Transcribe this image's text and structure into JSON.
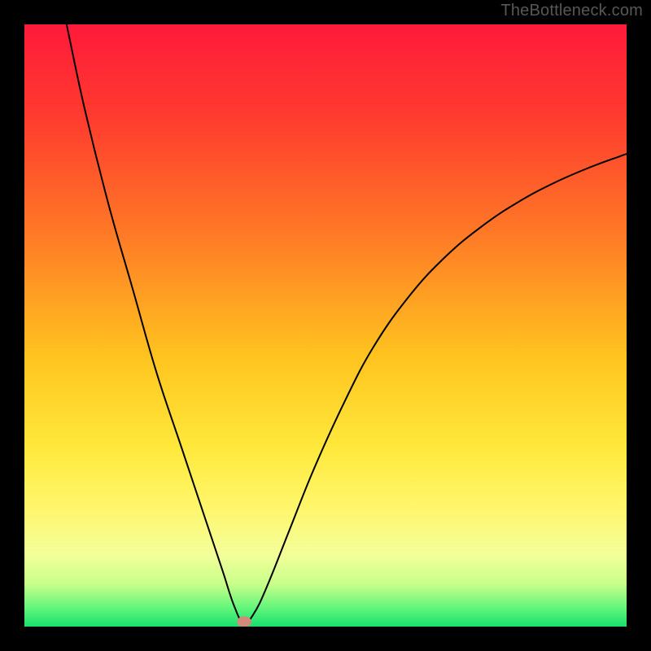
{
  "watermark": "TheBottleneck.com",
  "chart_data": {
    "type": "line",
    "title": "",
    "xlabel": "",
    "ylabel": "",
    "x_range": [
      0,
      100
    ],
    "y_range": [
      0,
      100
    ],
    "gradient_stops": [
      {
        "offset": 0.0,
        "color": "#ff1a3a"
      },
      {
        "offset": 0.15,
        "color": "#ff3a2f"
      },
      {
        "offset": 0.35,
        "color": "#ff7a26"
      },
      {
        "offset": 0.55,
        "color": "#ffc31f"
      },
      {
        "offset": 0.7,
        "color": "#ffe83a"
      },
      {
        "offset": 0.8,
        "color": "#fff66a"
      },
      {
        "offset": 0.88,
        "color": "#f4ff9a"
      },
      {
        "offset": 0.93,
        "color": "#c7ff8a"
      },
      {
        "offset": 0.97,
        "color": "#60f57a"
      },
      {
        "offset": 1.0,
        "color": "#17e070"
      }
    ],
    "series": [
      {
        "name": "bottleneck-curve",
        "color": "#000000",
        "points": [
          {
            "x": 7.0,
            "y": 100.0
          },
          {
            "x": 10.0,
            "y": 86.0
          },
          {
            "x": 14.0,
            "y": 70.0
          },
          {
            "x": 18.0,
            "y": 56.0
          },
          {
            "x": 22.0,
            "y": 42.0
          },
          {
            "x": 26.0,
            "y": 30.0
          },
          {
            "x": 30.0,
            "y": 18.0
          },
          {
            "x": 33.0,
            "y": 9.0
          },
          {
            "x": 35.0,
            "y": 3.0
          },
          {
            "x": 36.5,
            "y": 0.5
          },
          {
            "x": 38.0,
            "y": 2.0
          },
          {
            "x": 40.0,
            "y": 6.0
          },
          {
            "x": 44.0,
            "y": 16.0
          },
          {
            "x": 48.0,
            "y": 26.0
          },
          {
            "x": 53.0,
            "y": 37.0
          },
          {
            "x": 58.0,
            "y": 46.5
          },
          {
            "x": 64.0,
            "y": 55.0
          },
          {
            "x": 70.0,
            "y": 61.5
          },
          {
            "x": 76.0,
            "y": 66.5
          },
          {
            "x": 82.0,
            "y": 70.5
          },
          {
            "x": 88.0,
            "y": 73.7
          },
          {
            "x": 94.0,
            "y": 76.3
          },
          {
            "x": 100.0,
            "y": 78.5
          }
        ]
      }
    ],
    "marker": {
      "x": 36.5,
      "y": 0.8,
      "rx": 1.2,
      "ry": 0.9,
      "fill": "#d48a7a"
    }
  }
}
